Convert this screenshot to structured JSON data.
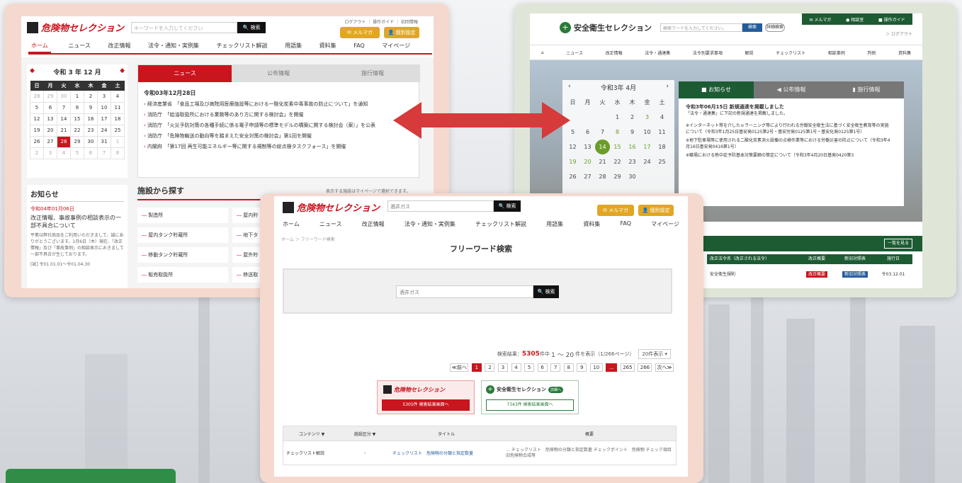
{
  "left": {
    "logo": "危険物セレクション",
    "search_placeholder": "キーワードを入力してください",
    "search_btn": "検索",
    "toplinks": "ログアウト ｜ 操作ガイド ｜ 初回情報",
    "mailmag": "メルマガ",
    "member": "個別設定",
    "nav": [
      "ホーム",
      "ニュース",
      "改正情報",
      "法令・通知・実例集",
      "チェックリスト解説",
      "用語集",
      "資料集",
      "FAQ",
      "マイページ"
    ],
    "cal_title": "令和 3 年 12 月",
    "cal_prev": "◆",
    "cal_next": "◆",
    "cal_head": [
      "日",
      "月",
      "火",
      "水",
      "木",
      "金",
      "土"
    ],
    "cal_rows": [
      [
        "28",
        "29",
        "30",
        "1",
        "2",
        "3",
        "4"
      ],
      [
        "5",
        "6",
        "7",
        "8",
        "9",
        "10",
        "11"
      ],
      [
        "12",
        "13",
        "14",
        "15",
        "16",
        "17",
        "18"
      ],
      [
        "19",
        "20",
        "21",
        "22",
        "23",
        "24",
        "25"
      ],
      [
        "26",
        "27",
        "28",
        "29",
        "30",
        "31",
        "1"
      ],
      [
        "2",
        "3",
        "4",
        "5",
        "6",
        "7",
        "8"
      ]
    ],
    "tabs": [
      "ニュース",
      "公布情報",
      "施行情報"
    ],
    "news_date": "令和03年12月28日",
    "news": [
      "経済産業省　「食品工場及び病院用医療施設等における一酸化炭素中毒事故の防止について」を通知",
      "消防庁　「給油取扱所における業務等のあり方に関する検討会」を開催",
      "消防庁　「火災予防対策の各種手続に係る電子申請等の標準モデルの構築に関する検討会（案）」を公表",
      "消防庁　「危険物輸送の動向等を踏まえた安全対策の検討会」第1回を開催",
      "内閣府　「第17回 再生可能エネルギー等に関する規制等の総点検タスクフォース」を開催"
    ],
    "notice_title": "お知らせ",
    "notice_date": "令和04年01月06日",
    "notice_head": "改正情報、事故事例の相談表示の一部不具合について",
    "notice_body": "平素は弊社商品をご利用いただきまして、誠にありがとうございます。1月6日（木）現在、「改正情報」及び「事故事例」の相談表示におきまして一部不具合が生じております。",
    "notice_range": "[試] 令01.01.01〜令01.04.30",
    "facility_title": "施設から探す",
    "facility_note": "表示する施設はマイページで選択できます。",
    "facilities": [
      "製造所",
      "屋内タンク貯蔵所",
      "移動タンク貯蔵所",
      "販売取扱所"
    ],
    "facilities2": [
      "屋内貯",
      "地下タ",
      "屋外貯",
      "移送取"
    ]
  },
  "right": {
    "logo": "安全衛生セレクション",
    "search_placeholder": "検索ワードを入力してください。",
    "search_btn": "検索",
    "adv_btn": "詳細検索",
    "top": [
      "メルマガ",
      "相談室",
      "操作ガイド"
    ],
    "logout": "＞ ログアウト",
    "nav": [
      "ニュース",
      "改正情報",
      "法令・通達集",
      "法令別要求事項",
      "解説",
      "チェックリスト",
      "相談事例",
      "判例",
      "資料集"
    ],
    "cal_title": "令和3年 4月",
    "cal_head": [
      "日",
      "月",
      "火",
      "水",
      "木",
      "金",
      "土"
    ],
    "cal_rows": [
      [
        "",
        "",
        "",
        "1",
        "2",
        "3",
        "4"
      ],
      [
        "5",
        "6",
        "7",
        "8",
        "9",
        "10",
        "11"
      ],
      [
        "12",
        "13",
        "14",
        "15",
        "16",
        "17",
        "18"
      ],
      [
        "19",
        "20",
        "21",
        "22",
        "23",
        "24",
        "25"
      ],
      [
        "26",
        "27",
        "28",
        "29",
        "30",
        "",
        ""
      ]
    ],
    "tabs": [
      "お知らせ",
      "公布情報",
      "施行情報"
    ],
    "notice_head": "令和3年06月15日 新規通達を掲載しました",
    "notice_sub": "「法令・通達集」に下記の新規通達を掲載しました。",
    "notice_body": [
      "※インターネット等を介したｅラーニング等により行われる労働安全衛生法に基づく安全衛生教育等の実施について（令和3年1月25日基安発0125第2号・基安労発0125第1号・基安化発0125第1号）",
      "※地下駐車場等に使用される二酸化炭素消火設備の点検作業等における労働災害の防止について（令和3年4月16日基安発0416第1号）",
      "※職場における熱中症予防基本対策要綱の策定について（令和3年4月20日基発0420第3"
    ],
    "more_btn": "一覧を見る",
    "table_head": [
      "改正法令名（改正される法令）",
      "改正概要",
      "新旧対照表",
      "施行日"
    ],
    "table_row": [
      "安全衛生規則",
      "改正概要",
      "新旧対照表",
      "令03.12.01"
    ]
  },
  "center": {
    "logo": "危険物セレクション",
    "search_value": "酒井ガス",
    "search_btn": "検索",
    "mailmag": "メルマガ",
    "member": "個別設定",
    "nav": [
      "ホーム",
      "ニュース",
      "改正情報",
      "法令・通知・実例集",
      "チェックリスト解説",
      "用語集",
      "資料集",
      "FAQ",
      "マイページ"
    ],
    "breadcrumb": "ホーム ＞ フリーワード検索",
    "page_title": "フリーワード検索",
    "inner_search": "酒井ガス",
    "inner_btn": "検索",
    "result_label": "検索結果：",
    "result_count": "5305",
    "result_unit": "件中",
    "result_range": "1 〜 20",
    "result_tail": "件を表示（1/266ページ）",
    "per_page": "20件表示 ▾",
    "pages": [
      "2",
      "3",
      "4",
      "5",
      "6",
      "7",
      "8",
      "9",
      "10"
    ],
    "page_cur": "1",
    "page_prev": "≪前へ",
    "page_dots": "...",
    "page_last": [
      "265",
      "266"
    ],
    "page_next": "次へ≫",
    "card1_logo": "危険物セレクション",
    "card1_btn": "5305件 検索結果画面へ",
    "card2_logo": "安全衛生セレクション",
    "card2_tag": "詳細へ",
    "card2_btn": "7343件 検索結果画面へ",
    "th": [
      "コンテンツ",
      "施設区分",
      "タイトル",
      "概要"
    ],
    "row": [
      "チェックリスト解説",
      "-",
      "チェックリスト　危険物の分類と指定数量",
      "… チェックリスト　危険物の分類と指定数量 チェックポイント　危険物 チェック項目 旧危険物合成等"
    ]
  },
  "colors": {
    "red": "#c9151e",
    "green": "#2a7a3a",
    "gold": "#e2a623"
  }
}
